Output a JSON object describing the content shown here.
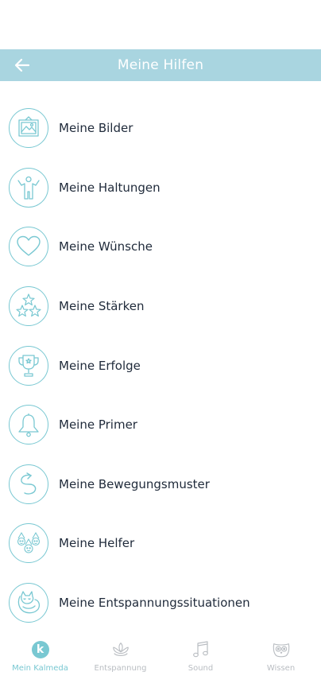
{
  "header": {
    "title": "Meine Hilfen",
    "background_color": "#a9d5e0",
    "back_icon": "arrow-left-icon"
  },
  "list": {
    "accent_color": "#79c8d2",
    "items": [
      {
        "label": "Meine Bilder",
        "icon": "picture-icon"
      },
      {
        "label": "Meine Haltungen",
        "icon": "posture-figure-icon"
      },
      {
        "label": "Meine Wünsche",
        "icon": "heart-icon"
      },
      {
        "label": "Meine Stärken",
        "icon": "stars-icon"
      },
      {
        "label": "Meine Erfolge",
        "icon": "trophy-icon"
      },
      {
        "label": "Meine Primer",
        "icon": "bell-icon"
      },
      {
        "label": "Meine Bewegungsmuster",
        "icon": "movement-path-icon"
      },
      {
        "label": "Meine Helfer",
        "icon": "helpers-faces-icon"
      },
      {
        "label": "Meine Entspannungssituationen",
        "icon": "sleeping-cat-icon"
      }
    ]
  },
  "tabbar": {
    "tabs": [
      {
        "label": "Mein Kalmeda",
        "icon": "kalmeda-k-icon",
        "active": true,
        "badge_letter": "k"
      },
      {
        "label": "Entspannung",
        "icon": "lotus-icon",
        "active": false
      },
      {
        "label": "Sound",
        "icon": "music-note-icon",
        "active": false
      },
      {
        "label": "Wissen",
        "icon": "owl-icon",
        "active": false
      }
    ],
    "active_color": "#79c8d2",
    "inactive_color": "#b9bdc2"
  }
}
